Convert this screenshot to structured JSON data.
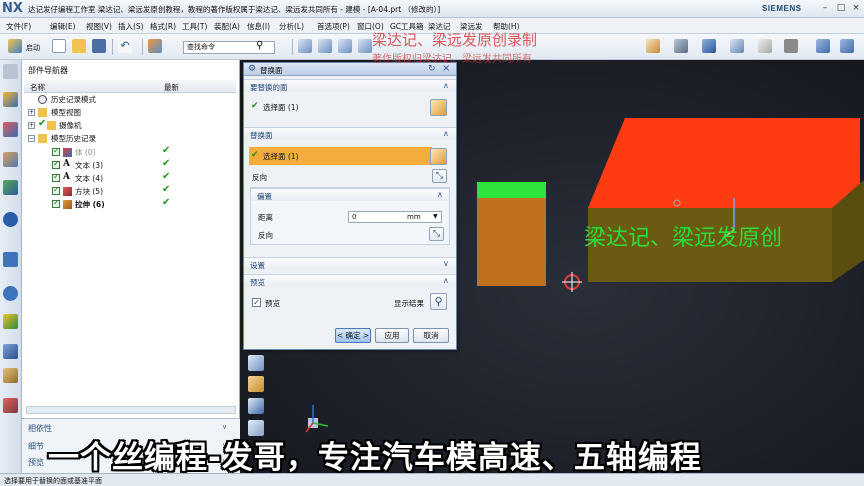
{
  "app": {
    "logo": "NX",
    "title": "达记发仔编程工作室  梁达记、梁远发原创教程，教程的著作版权属于梁达记、梁远发共同所有 - 建模 - [A-04.prt （修改的）]",
    "brand": "SIEMENS"
  },
  "menu": [
    "文件(F)",
    "编辑(E)",
    "视图(V)",
    "插入(S)",
    "格式(R)",
    "工具(T)",
    "装配(A)",
    "信息(I)",
    "分析(L)",
    "首选项(P)",
    "窗口(O)",
    "GC工具箱",
    "梁达记",
    "梁远发",
    "帮助(H)"
  ],
  "toolbar": {
    "start_label": "启动",
    "search_placeholder": "查找命令"
  },
  "navigator": {
    "title": "部件导航器",
    "col_name": "名称",
    "col_latest": "最新",
    "tree": [
      {
        "label": "历史记录模式"
      },
      {
        "label": "模型视图"
      },
      {
        "label": "摄像机"
      },
      {
        "label": "模型历史记录"
      },
      {
        "label": "体 (0)",
        "latest": "✔"
      },
      {
        "label": "文本 (3)",
        "latest": "✔"
      },
      {
        "label": "文本 (4)",
        "latest": "✔"
      },
      {
        "label": "方块 (5)",
        "latest": "✔"
      },
      {
        "label": "拉伸 (6)",
        "latest": "✔"
      }
    ],
    "sections": [
      "相依性",
      "细节",
      "预览"
    ]
  },
  "dialog": {
    "title": "替换面",
    "section_target": "要替换的面",
    "target_value": "选择面 (1)",
    "section_replace": "替换面",
    "replace_value": "选择面 (1)",
    "reverse_label": "反向",
    "offset_section": "偏置",
    "distance_label": "距离",
    "distance_value": "0",
    "distance_unit": "mm",
    "offset_reverse_label": "反向",
    "settings_label": "设置",
    "preview_section": "预览",
    "preview_checkbox": "预览",
    "show_result": "显示结果",
    "ok": "< 确定 >",
    "apply": "应用",
    "cancel": "取消"
  },
  "watermarks": {
    "top_line1": "梁达记、梁远发原创录制",
    "top_line2": "著作版权归梁达记、梁远发共同所有",
    "side": "梁达记、梁远发原创"
  },
  "subtitle": "一个丝编程-发哥，专注汽车模高速、五轴编程",
  "status": "选择要用于替换的面或基准平面",
  "colors": {
    "top_face_red": "#ff3b12",
    "side_face_olive": "#6b5b12",
    "green_face": "#2ee23a",
    "brown_block": "#c0711e",
    "accent": "#3d69a8"
  }
}
